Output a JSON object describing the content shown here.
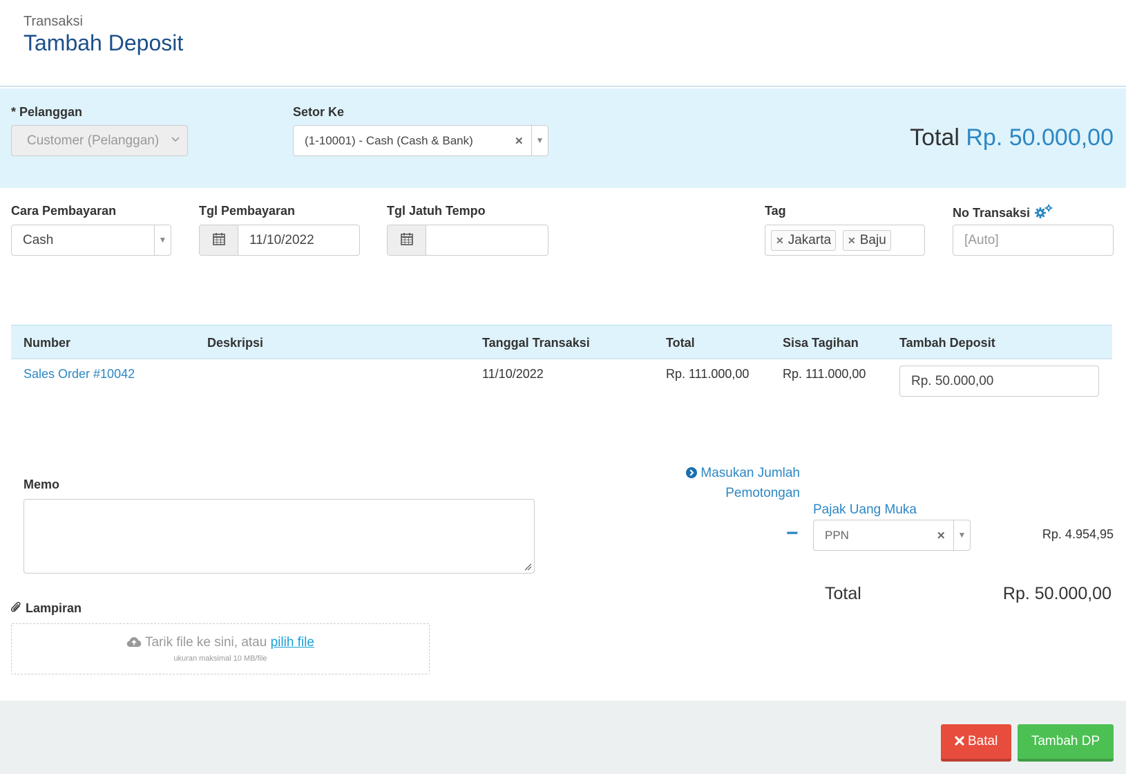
{
  "header": {
    "breadcrumb": "Transaksi",
    "title": "Tambah Deposit"
  },
  "customer": {
    "label": "* Pelanggan",
    "placeholder": "Customer (Pelanggan)"
  },
  "deposit_to": {
    "label": "Setor Ke",
    "value": "(1-10001) - Cash (Cash & Bank)"
  },
  "summary": {
    "total_label": "Total",
    "total_value": "Rp. 50.000,00"
  },
  "payment": {
    "method_label": "Cara Pembayaran",
    "method_value": "Cash",
    "date_label": "Tgl Pembayaran",
    "date_value": "11/10/2022",
    "due_label": "Tgl Jatuh Tempo",
    "due_value": ""
  },
  "tags": {
    "label": "Tag",
    "items": [
      "Jakarta",
      "Baju"
    ]
  },
  "transaction_no": {
    "label": "No Transaksi",
    "placeholder": "[Auto]"
  },
  "table": {
    "headers": [
      "Number",
      "Deskripsi",
      "Tanggal Transaksi",
      "Total",
      "Sisa Tagihan",
      "Tambah Deposit"
    ],
    "rows": [
      {
        "number": "Sales Order #10042",
        "description": "",
        "date": "11/10/2022",
        "total": "Rp. 111.000,00",
        "remaining": "Rp. 111.000,00",
        "deposit": "Rp. 50.000,00"
      }
    ]
  },
  "memo": {
    "label": "Memo",
    "value": ""
  },
  "deduction": {
    "link_line1": "Masukan Jumlah",
    "link_line2": "Pemotongan",
    "tax_label": "Pajak Uang Muka",
    "tax_value": "PPN",
    "tax_amount": "Rp. 4.954,95",
    "minus": "−"
  },
  "grand_total": {
    "label": "Total",
    "value": "Rp. 50.000,00"
  },
  "attachment": {
    "label": "Lampiran",
    "drop_text": "Tarik file ke sini, atau ",
    "choose_link": "pilih file",
    "limit_text": "ukuran maksimal 10 MB/file"
  },
  "actions": {
    "cancel": "Batal",
    "submit": "Tambah DP"
  },
  "colors": {
    "accent": "#2c87c4",
    "title": "#1b4f8a",
    "cancel": "#e74c3c",
    "submit": "#4cc053",
    "highlight_bg": "#dff3fc"
  }
}
